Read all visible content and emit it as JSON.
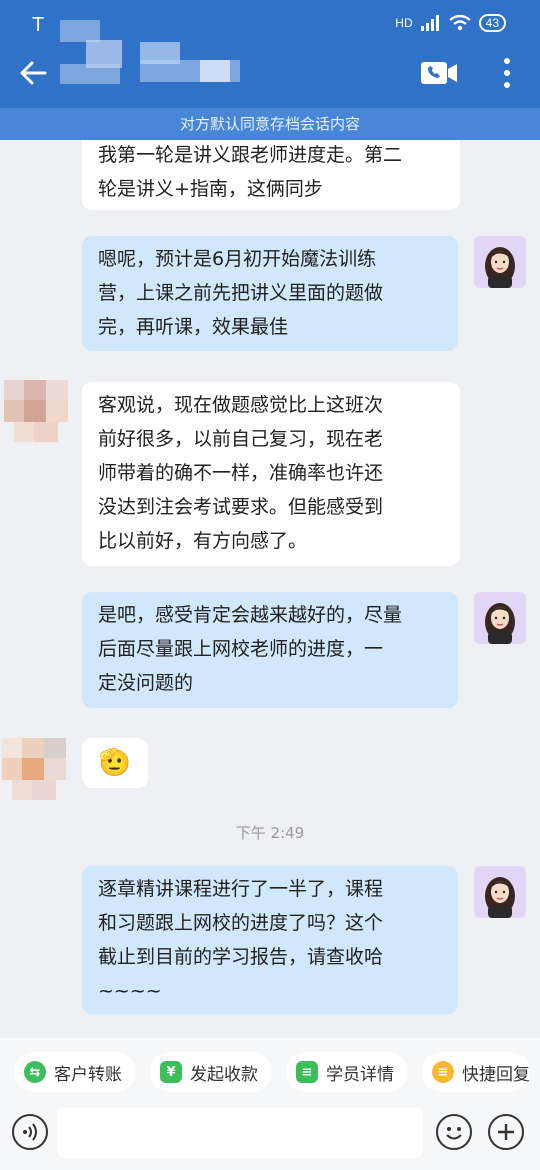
{
  "status_bar": {
    "carrier": "T",
    "network": "HD",
    "battery": "43"
  },
  "header": {
    "banner": "对方默认同意存档会话内容"
  },
  "messages": [
    {
      "from": "other",
      "lines": [
        "我第一轮是讲义跟老师进度走。第二",
        "轮是讲义+指南，这俩同步"
      ]
    },
    {
      "from": "me",
      "lines": [
        "嗯呢，预计是6月初开始魔法训练",
        "营，上课之前先把讲义里面的题做",
        "完，再听课，效果最佳"
      ]
    },
    {
      "from": "other",
      "lines": [
        "客观说，现在做题感觉比上这班次",
        "前好很多，以前自己复习，现在老",
        "师带着的确不一样，准确率也许还",
        "没达到注会考试要求。但能感受到",
        "比以前好，有方向感了。"
      ]
    },
    {
      "from": "me",
      "lines": [
        "是吧，感受肯定会越来越好的，尽量",
        "后面尽量跟上网校老师的进度，一",
        "定没问题的"
      ]
    },
    {
      "from": "other",
      "emoji": "🫡"
    },
    {
      "time": "下午 2:49"
    },
    {
      "from": "me",
      "lines": [
        "逐章精讲课程进行了一半了，课程",
        "和习题跟上网校的进度了吗？这个",
        "截止到目前的学习报告，请查收哈",
        "~~~~"
      ]
    }
  ],
  "quick_actions": [
    {
      "label": "客户转账",
      "icon": "transfer-icon",
      "color": "#3cbf5a",
      "glyph": "⇆"
    },
    {
      "label": "发起收款",
      "icon": "yuan-shield-icon",
      "color": "#3cbf5a",
      "glyph": "¥"
    },
    {
      "label": "学员详情",
      "icon": "user-detail-icon",
      "color": "#3cbf5a",
      "glyph": "≡"
    },
    {
      "label": "快捷回复",
      "icon": "quick-reply-icon",
      "color": "#f5b82e",
      "glyph": "≡"
    }
  ],
  "colors": {
    "header": "#2f72c8",
    "banner": "#4986d6",
    "bubble_out": "#d1e7fb",
    "bubble_in": "#ffffff"
  }
}
